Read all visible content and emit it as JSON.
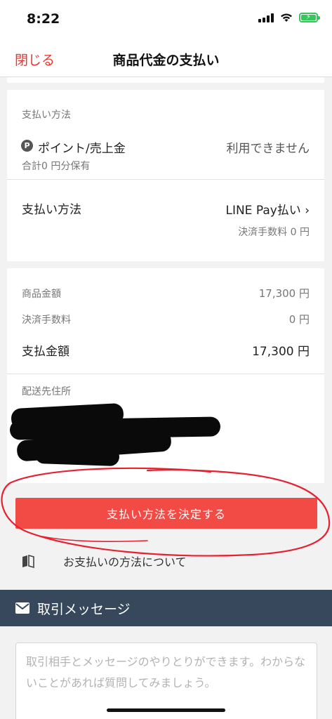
{
  "status": {
    "time": "8:22"
  },
  "nav": {
    "close_label": "閉じる",
    "title": "商品代金の支払い"
  },
  "payment": {
    "section_label": "支払い方法",
    "points_label": "ポイント/売上金",
    "points_status": "利用できません",
    "points_owned": "合計0 円分保有",
    "method_label": "支払い方法",
    "method_value": "LINE Pay払い ›",
    "method_fee": "決済手数料 0 円"
  },
  "summary": {
    "item_price_label": "商品金額",
    "item_price_value": "17,300 円",
    "fee_label": "決済手数料",
    "fee_value": "0 円",
    "total_label": "支払金額",
    "total_value": "17,300 円",
    "address_label": "配送先住所"
  },
  "actions": {
    "decide_label": "支払い方法を決定する",
    "about_label": "お支払いの方法について"
  },
  "message": {
    "header": "取引メッセージ",
    "placeholder": "取引相手とメッセージのやりとりができます。わからないことがあれば質問してみましょう。"
  },
  "colors": {
    "accent": "#ea352d",
    "button": "#f24b46",
    "header_bg": "#37475c",
    "annotation": "#e8202f",
    "battery": "#34c759"
  },
  "icons": [
    "point-icon",
    "book-icon",
    "mail-icon",
    "wifi-icon",
    "battery-icon"
  ]
}
